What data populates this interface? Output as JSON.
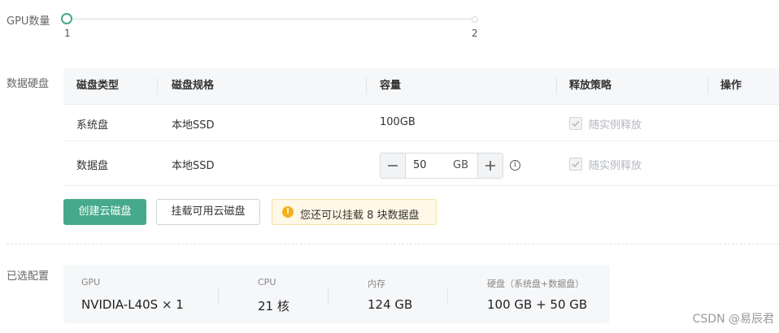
{
  "gpu_count": {
    "label": "GPU数量",
    "min_label": "1",
    "max_label": "2",
    "value": 1
  },
  "data_disk": {
    "label": "数据硬盘",
    "columns": [
      "磁盘类型",
      "磁盘规格",
      "容量",
      "释放策略",
      "操作"
    ],
    "rows": [
      {
        "type": "系统盘",
        "spec": "本地SSD",
        "capacity": "100GB",
        "release_label": "随实例释放",
        "release_checked": true
      },
      {
        "type": "数据盘",
        "spec": "本地SSD",
        "capacity_value": "50",
        "capacity_unit": "GB",
        "release_label": "随实例释放",
        "release_checked": true
      }
    ],
    "create_button": "创建云磁盘",
    "attach_button": "挂载可用云磁盘",
    "notice": "您还可以挂载 8 块数据盘"
  },
  "selected_config": {
    "label": "已选配置",
    "items": [
      {
        "title": "GPU",
        "value": "NVIDIA-L40S × 1"
      },
      {
        "title": "CPU",
        "value": "21 核"
      },
      {
        "title": "内存",
        "value": "124 GB"
      },
      {
        "title": "硬盘（系统盘+数据盘）",
        "value": "100 GB + 50 GB"
      }
    ]
  },
  "watermark": "CSDN @易辰君",
  "colors": {
    "accent": "#46a98a",
    "warning": "#f4b01d",
    "notice_bg": "#fff8e6"
  }
}
